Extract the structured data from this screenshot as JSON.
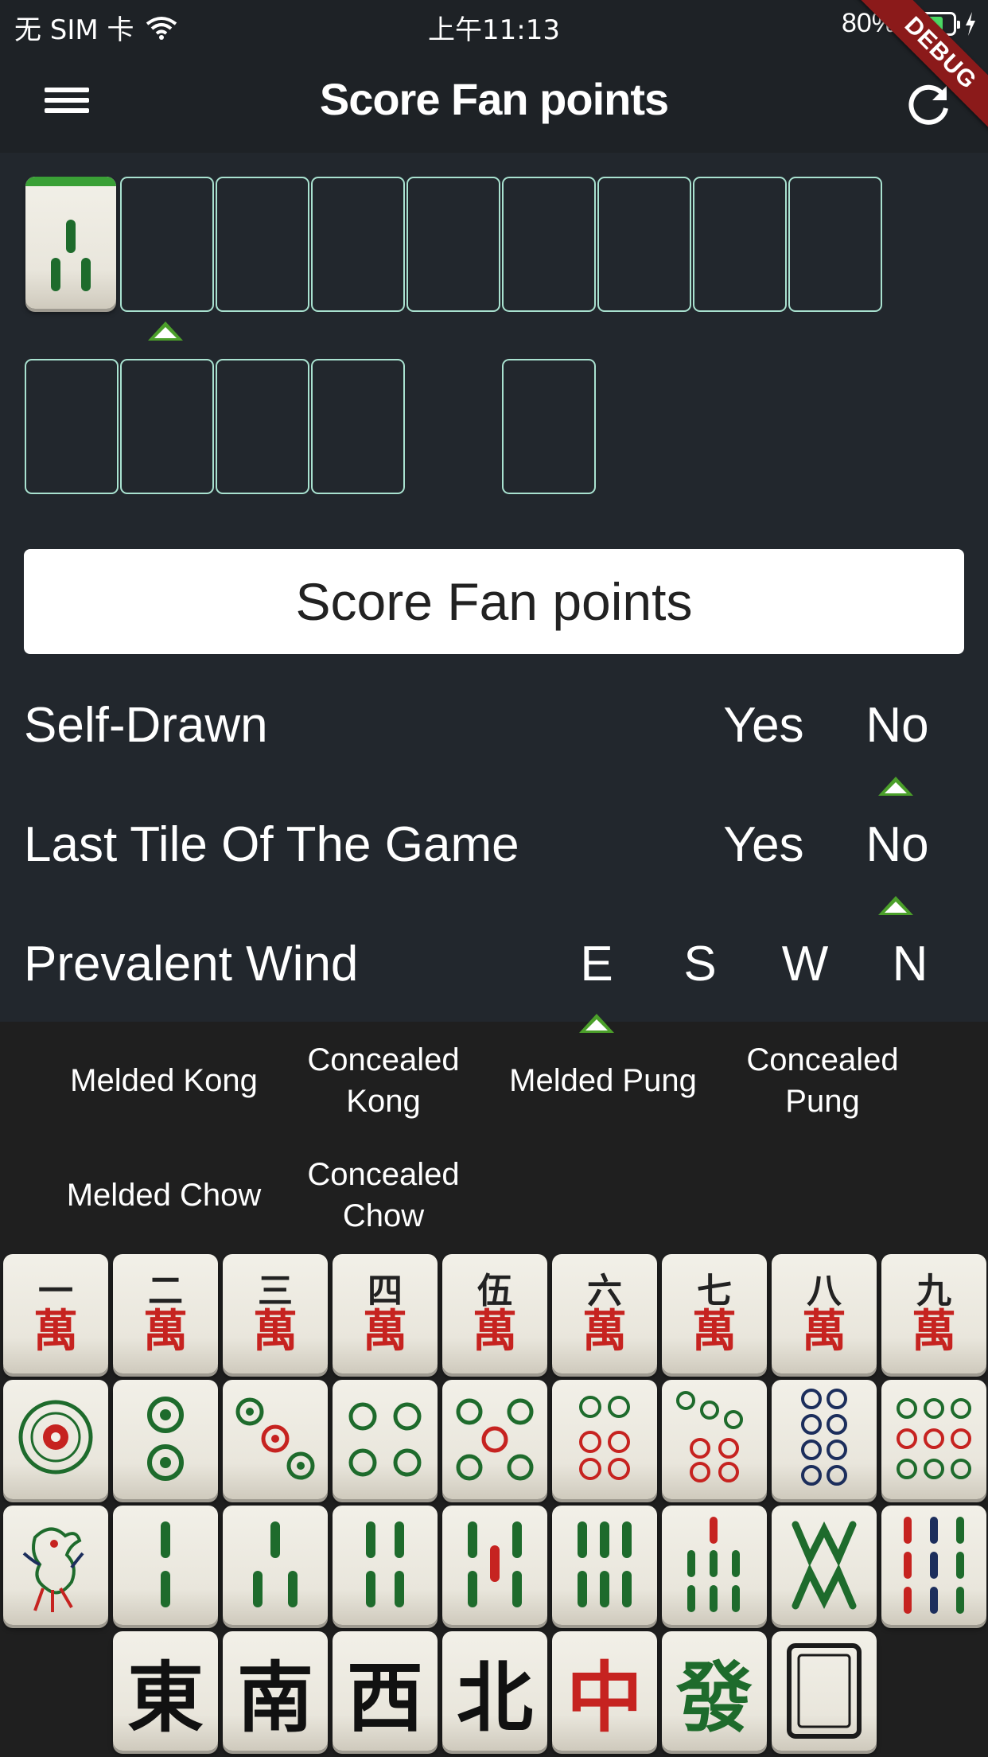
{
  "status_bar": {
    "carrier": "无 SIM 卡",
    "time": "上午11:13",
    "battery": "80%",
    "battery_level": 0.8,
    "icons": [
      "wifi-icon",
      "battery-icon",
      "charging-icon"
    ]
  },
  "app_bar": {
    "title": "Score Fan points",
    "debug_banner": "DEBUG",
    "icons": [
      "menu-icon",
      "refresh-icon"
    ]
  },
  "hand": {
    "placed_tile": "bamboo-3",
    "empty_slots_row1": 8,
    "empty_slots_row2": 5
  },
  "score_button": {
    "label": "Score Fan points"
  },
  "options": {
    "self_drawn": {
      "label": "Self-Drawn",
      "yes": "Yes",
      "no": "No",
      "selected": "No"
    },
    "last_tile": {
      "label": "Last Tile Of The Game",
      "yes": "Yes",
      "no": "No",
      "selected": "No"
    },
    "prevalent_wind": {
      "label": "Prevalent Wind",
      "e": "E",
      "s": "S",
      "w": "W",
      "n": "N",
      "selected": "E"
    }
  },
  "meld_buttons": {
    "melded_kong": "Melded Kong",
    "concealed_kong": "Concealed\nKong",
    "melded_pung": "Melded Pung",
    "concealed_pung": "Concealed\nPung",
    "melded_chow": "Melded Chow",
    "concealed_chow": "Concealed\nChow"
  },
  "tiles": {
    "characters": [
      {
        "num": "一",
        "wan": "萬"
      },
      {
        "num": "二",
        "wan": "萬"
      },
      {
        "num": "三",
        "wan": "萬"
      },
      {
        "num": "四",
        "wan": "萬"
      },
      {
        "num": "伍",
        "wan": "萬"
      },
      {
        "num": "六",
        "wan": "萬"
      },
      {
        "num": "七",
        "wan": "萬"
      },
      {
        "num": "八",
        "wan": "萬"
      },
      {
        "num": "九",
        "wan": "萬"
      }
    ],
    "honors": [
      "東",
      "南",
      "西",
      "北",
      "中",
      "發"
    ],
    "colors": {
      "red": "#c62320",
      "green": "#1e6b2c",
      "blue": "#1c2e5c",
      "accent": "#4b9f2a",
      "slot_border": "#a9e2d0"
    }
  }
}
